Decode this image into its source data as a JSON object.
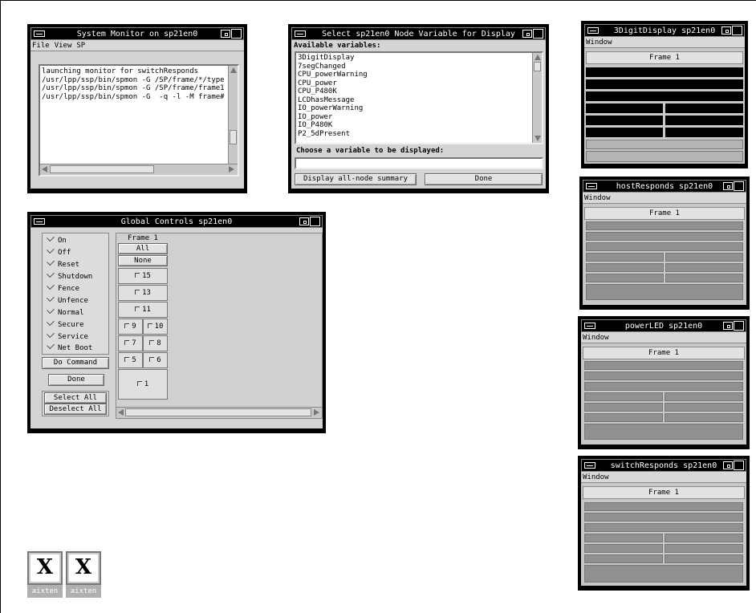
{
  "system_monitor": {
    "title": "System Monitor on sp21en0",
    "menu": [
      "File",
      "View",
      "SP"
    ],
    "log_lines": [
      "launching monitor for switchResponds",
      "/usr/lpp/ssp/bin/spmon -G /SP/frame/*/type",
      "/usr/lpp/ssp/bin/spmon -G /SP/frame/frame1",
      "/usr/lpp/ssp/bin/spmon -G  -q -l -M frame#"
    ]
  },
  "select_variable": {
    "title": "Select sp21en0 Node Variable for Display",
    "available_label": "Available variables:",
    "variables": [
      "3DigitDisplay",
      "7segChanged",
      "CPU_powerWarning",
      "CPU_power",
      "CPU_P480K",
      "LCDhasMessage",
      "IO_powerWarning",
      "IO_power",
      "IO_P480K",
      "P2_5dPresent"
    ],
    "choose_label": "Choose a variable to be displayed:",
    "choose_value": "",
    "summary_button": "Display all-node summary",
    "done_button": "Done"
  },
  "global_controls": {
    "title": "Global Controls sp21en0",
    "commands": [
      "On",
      "Off",
      "Reset",
      "Shutdown",
      "Fence",
      "Unfence",
      "Normal",
      "Secure",
      "Service",
      "Net Boot"
    ],
    "do_command": "Do Command",
    "done": "Done",
    "select_all": "Select All",
    "deselect_all": "Deselect All",
    "frame_label": "Frame 1",
    "all_button": "All",
    "none_button": "None",
    "nodes": [
      "15",
      "13",
      "11",
      "9",
      "10",
      "7",
      "8",
      "5",
      "6",
      "1"
    ]
  },
  "mini_windows": [
    {
      "title": "3DigitDisplay sp21en0",
      "menu": "Window",
      "frame": "Frame 1",
      "fill": "#000000"
    },
    {
      "title": "hostResponds sp21en0",
      "menu": "Window",
      "frame": "Frame 1",
      "fill": "#909090"
    },
    {
      "title": "powerLED sp21en0",
      "menu": "Window",
      "frame": "Frame 1",
      "fill": "#909090"
    },
    {
      "title": "switchResponds sp21en0",
      "menu": "Window",
      "frame": "Frame 1",
      "fill": "#909090"
    }
  ],
  "icons": [
    {
      "glyph": "X",
      "label": "aixten"
    },
    {
      "glyph": "X",
      "label": "aixten"
    }
  ]
}
